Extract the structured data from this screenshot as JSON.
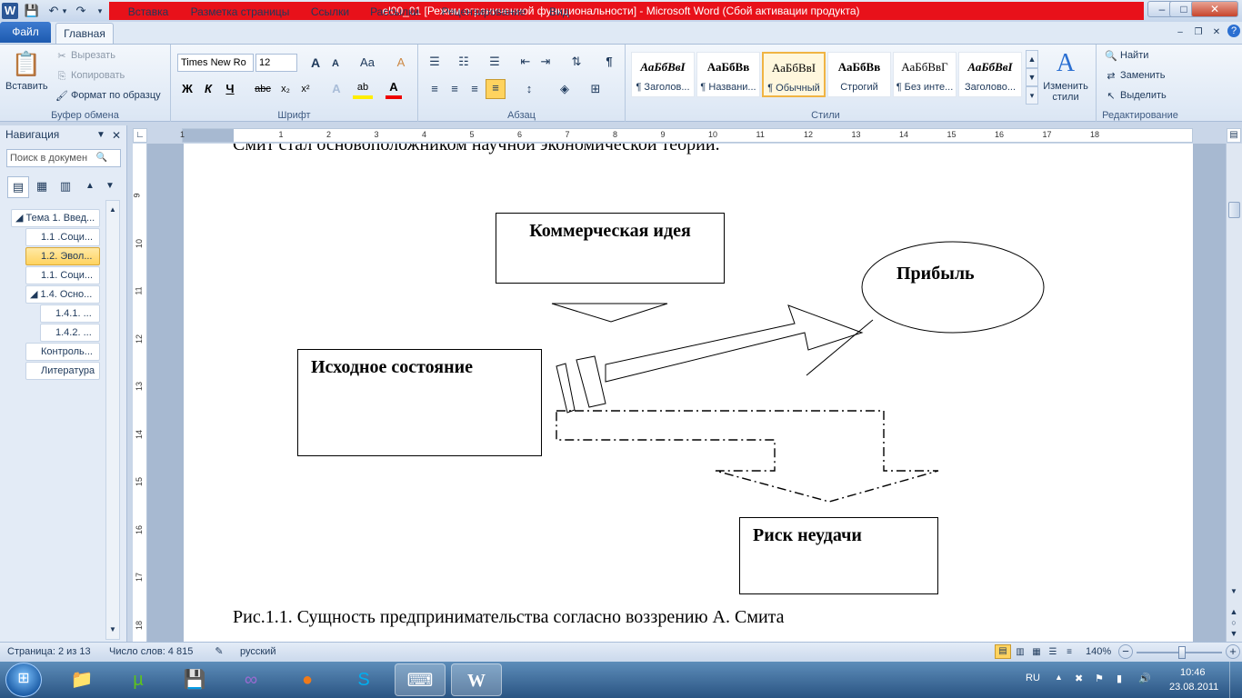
{
  "window": {
    "title": "el00_01 [Режим ограниченной функциональности]  -  Microsoft Word (Сбой активации продукта)",
    "controls": {
      "minimize": "–",
      "maximize": "□",
      "close": "✕"
    },
    "inner_controls": {
      "minimize": "–",
      "restore": "❐",
      "close": "✕"
    }
  },
  "quick_access": {
    "app_icon": "W",
    "save_icon": "💾",
    "undo_icon": "↶",
    "redo_icon": "↷",
    "more": "▾"
  },
  "tabs": [
    {
      "label": "Файл"
    },
    {
      "label": "Главная"
    },
    {
      "label": "Вставка"
    },
    {
      "label": "Разметка страницы"
    },
    {
      "label": "Ссылки"
    },
    {
      "label": "Рассылки"
    },
    {
      "label": "Рецензирование"
    },
    {
      "label": "Вид"
    }
  ],
  "ribbon": {
    "clipboard": {
      "label": "Буфер обмена",
      "paste": "Вставить",
      "cut": "Вырезать",
      "copy": "Копировать",
      "format_painter": "Формат по образцу"
    },
    "font": {
      "label": "Шрифт",
      "font_name": "Times New Ro",
      "font_size": "12",
      "grow": "A",
      "shrink": "A",
      "case": "Aa",
      "clear": "A",
      "bold": "Ж",
      "italic": "К",
      "underline": "Ч",
      "strike": "abc",
      "sub": "x₂",
      "sup": "x²",
      "effects": "A",
      "highlight": "ab",
      "color": "A"
    },
    "paragraph": {
      "label": "Абзац",
      "pilcrow": "¶"
    },
    "styles": {
      "label": "Стили",
      "items": [
        {
          "preview": "АаБбВвІ",
          "name": "¶ Заголов..."
        },
        {
          "preview": "АаБбВв",
          "name": "¶ Названи..."
        },
        {
          "preview": "АаБбВвІ",
          "name": "¶ Обычный"
        },
        {
          "preview": "АаБбВв",
          "name": "Строгий"
        },
        {
          "preview": "АаБбВвГ",
          "name": "¶ Без инте..."
        },
        {
          "preview": "АаБбВвІ",
          "name": "Заголово..."
        }
      ],
      "change_styles": "Изменить стили"
    },
    "editing": {
      "label": "Редактирование",
      "find": "Найти",
      "replace": "Заменить",
      "select": "Выделить"
    }
  },
  "navigation": {
    "title": "Навигация",
    "search_placeholder": "Поиск в докумен",
    "items": [
      {
        "label": "◢ Тема 1. Введ..."
      },
      {
        "label": "1.1 .Соци..."
      },
      {
        "label": "1.2. Эвол..."
      },
      {
        "label": "1.1. Соци..."
      },
      {
        "label": "◢ 1.4. Осно..."
      },
      {
        "label": "1.4.1. ..."
      },
      {
        "label": "1.4.2. ..."
      },
      {
        "label": "Контроль..."
      },
      {
        "label": "Литература"
      }
    ]
  },
  "ruler": {
    "h_ticks": [
      "1",
      "1",
      "2",
      "3",
      "4",
      "5",
      "6",
      "7",
      "8",
      "9",
      "10",
      "11",
      "12",
      "13",
      "14",
      "15",
      "16",
      "17",
      "18"
    ],
    "v_ticks": [
      "9",
      "10",
      "11",
      "12",
      "13",
      "14",
      "15",
      "16",
      "17",
      "18"
    ]
  },
  "document": {
    "top_text": "Смит стал основоположником научной экономической теории.",
    "box_idea": "Коммерческая идея",
    "box_profit": "Прибыль",
    "box_initial": "Исходное состояние",
    "box_risk": "Риск неудачи",
    "caption": "Рис.1.1. Сущность предпринимательства согласно воззрению А. Смита"
  },
  "statusbar": {
    "page": "Страница: 2 из 13",
    "words": "Число слов: 4 815",
    "language": "русский",
    "zoom": "140%",
    "zoom_minus": "−",
    "zoom_plus": "+"
  },
  "taskbar": {
    "tray_lang": "RU",
    "time": "10:46",
    "date": "23.08.2011"
  }
}
